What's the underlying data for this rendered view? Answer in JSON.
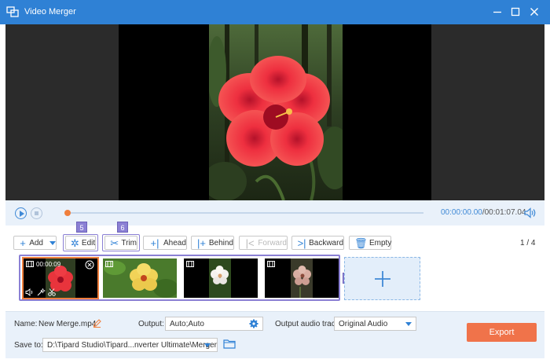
{
  "window": {
    "title": "Video Merger"
  },
  "playback": {
    "current_time": "00:00:00.00",
    "separator": "/",
    "total_time": "00:01:07.04"
  },
  "toolbar": {
    "add_label": "Add",
    "edit_label": "Edit",
    "trim_label": "Trim",
    "ahead_label": "Ahead",
    "behind_label": "Behind",
    "forward_label": "Forward",
    "backward_label": "Backward",
    "empty_label": "Empty"
  },
  "badges": {
    "edit": "5",
    "trim": "6",
    "timeline": "4"
  },
  "pager": {
    "text": "1 / 4"
  },
  "clips": [
    {
      "duration": "00:00:09",
      "subject": "red hibiscus",
      "selected": true
    },
    {
      "subject": "yellow hibiscus",
      "selected": false
    },
    {
      "subject": "white flower",
      "selected": false
    },
    {
      "subject": "pink flower",
      "selected": false
    }
  ],
  "footer": {
    "name_label": "Name:",
    "name_value": "New Merge.mp4",
    "output_label": "Output:",
    "output_value": "Auto;Auto",
    "audio_label": "Output audio track:",
    "audio_value": "Original Audio",
    "save_label": "Save to:",
    "save_path": "D:\\Tipard Studio\\Tipard...nverter Ultimate\\Merger",
    "export_label": "Export"
  },
  "colors": {
    "titlebar": "#2f81d5",
    "accent": "#3f89d6",
    "export": "#f0734a",
    "highlight": "#8b80d4",
    "progress_knob": "#f07f3d"
  }
}
